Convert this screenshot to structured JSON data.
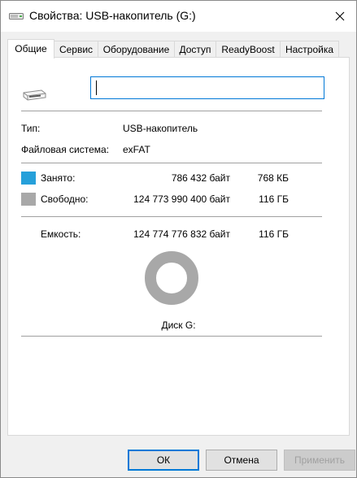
{
  "window": {
    "title": "Свойства: USB-накопитель (G:)",
    "close_glyph": "✕"
  },
  "tabs": [
    {
      "label": "Общие",
      "active": true
    },
    {
      "label": "Сервис",
      "active": false
    },
    {
      "label": "Оборудование",
      "active": false
    },
    {
      "label": "Доступ",
      "active": false
    },
    {
      "label": "ReadyBoost",
      "active": false
    },
    {
      "label": "Настройка",
      "active": false
    }
  ],
  "general": {
    "name_value": "",
    "type_label": "Тип:",
    "type_value": "USB-накопитель",
    "fs_label": "Файловая система:",
    "fs_value": "exFAT",
    "used_label": "Занято:",
    "used_bytes": "786 432 байт",
    "used_short": "768 КБ",
    "free_label": "Свободно:",
    "free_bytes": "124 773 990 400 байт",
    "free_short": "116 ГБ",
    "capacity_label": "Емкость:",
    "capacity_bytes": "124 774 776 832 байт",
    "capacity_short": "116 ГБ",
    "disk_label": "Диск G:"
  },
  "usage": {
    "used_fraction": 6.3e-06,
    "used_color": "#26a0da",
    "free_color": "#a8a8a8"
  },
  "buttons": {
    "ok": "ОК",
    "cancel": "Отмена",
    "apply": "Применить"
  },
  "icons": {
    "title": "usb-drive-icon",
    "drive": "usb-drive-icon",
    "close": "close-icon"
  }
}
